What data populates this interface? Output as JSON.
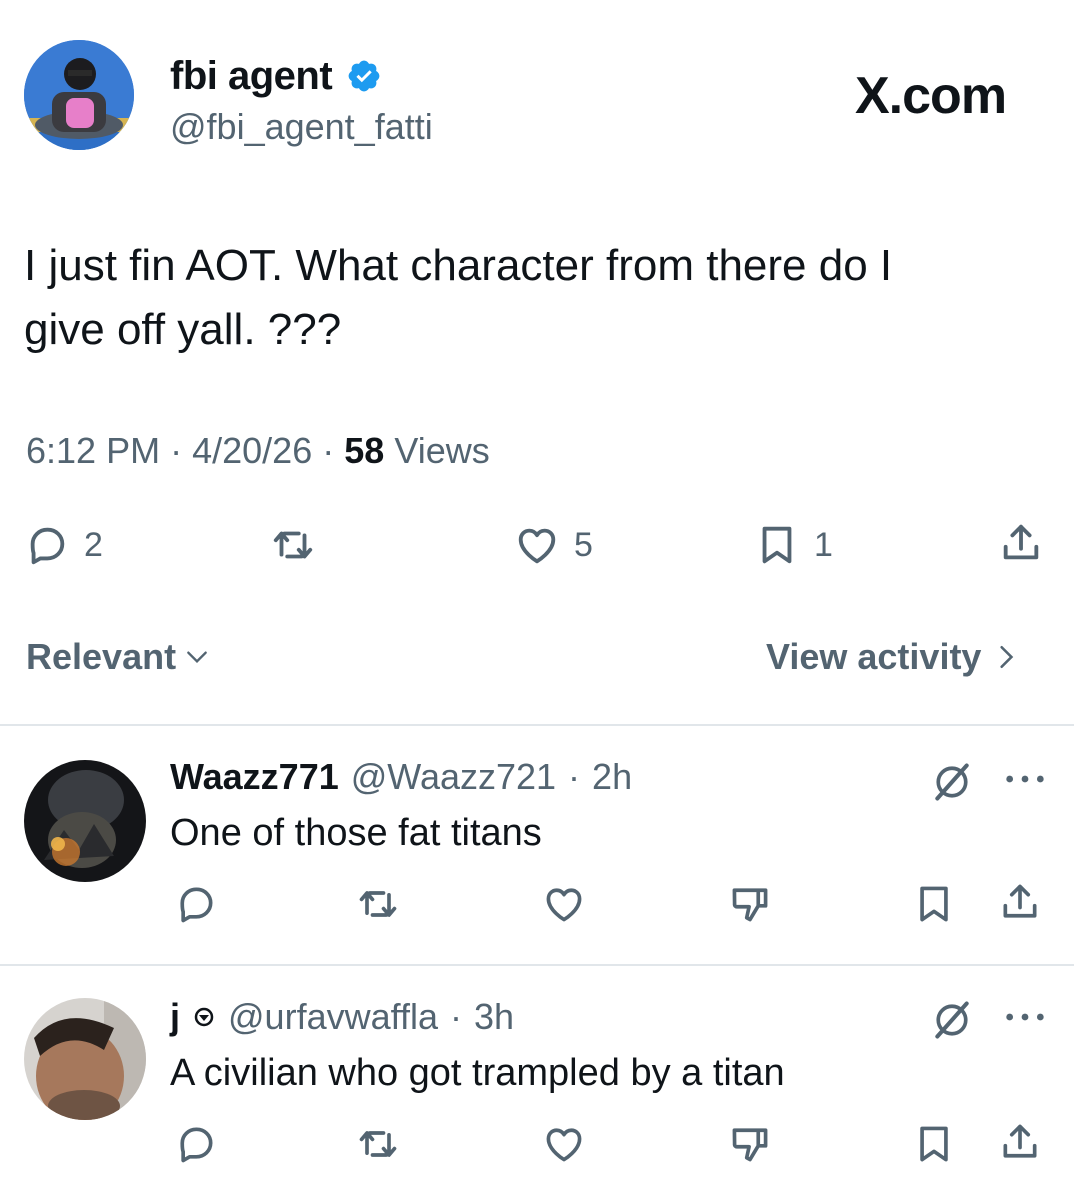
{
  "tweet": {
    "display_name": "fbi agent",
    "handle": "@fbi_agent_fatti",
    "brand": "X.com",
    "text_line1": "I just fin AOT. What character from there do I",
    "text_line2": "give off yall. ???",
    "time": "6:12 PM",
    "date": "4/20/26",
    "views_count": "58",
    "views_label": "Views",
    "separator": "·",
    "replies": "2",
    "likes": "5",
    "bookmarks": "1"
  },
  "sort": {
    "label": "Relevant",
    "activity": "View activity"
  },
  "replies": [
    {
      "name": "Waazz771",
      "handle": "@Waazz721",
      "age": "2h",
      "text": "One of those fat titans"
    },
    {
      "name": "j",
      "handle": "@urfavwaffla",
      "age": "3h",
      "text": "A civilian who got trampled by a titan"
    }
  ],
  "colors": {
    "text": "#0f1419",
    "secondary": "#536471",
    "verified": "#1d9bf0",
    "divider": "#e1e6ea"
  },
  "icons": [
    "verified-badge-icon",
    "reply-icon",
    "repost-icon",
    "like-icon",
    "bookmark-icon",
    "share-icon",
    "chevron-down-icon",
    "chevron-right-icon",
    "grok-icon",
    "more-icon",
    "dislike-icon",
    "ring-icon"
  ]
}
